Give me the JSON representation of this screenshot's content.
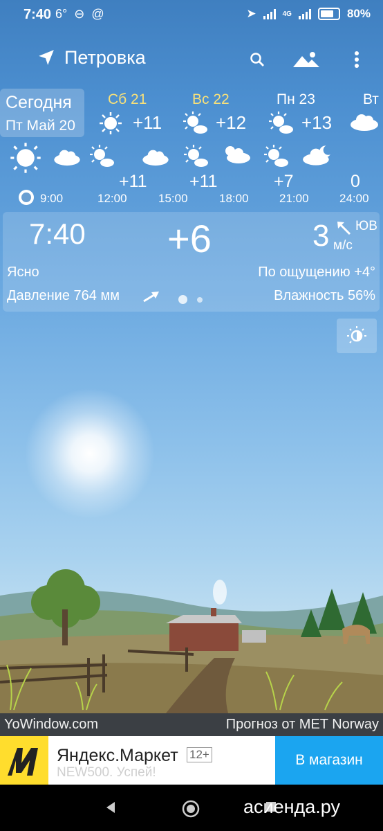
{
  "status_bar": {
    "time": "7:40",
    "temp_badge": "6°",
    "network": "4G",
    "battery": "80%"
  },
  "app_bar": {
    "location": "Петровка",
    "icons": [
      "location-arrow-icon",
      "search-icon",
      "landscape-icon",
      "more-icon"
    ]
  },
  "days": [
    {
      "name": "Сегодня",
      "date": "Пт Май 20"
    },
    {
      "name": "Сб 21",
      "temp": "+11",
      "icon": "sun-icon"
    },
    {
      "name": "Вс 22",
      "temp": "+12",
      "icon": "sun-cloud-icon"
    },
    {
      "name": "Пн 23",
      "temp": "+13",
      "icon": "sun-cloud-icon"
    },
    {
      "name": "Вт",
      "icon": "cloud-icon"
    }
  ],
  "hourly": {
    "temps": [
      "+11",
      "+11",
      "+7",
      "0"
    ],
    "times": [
      "9:00",
      "12:00",
      "15:00",
      "18:00",
      "21:00",
      "24:00"
    ]
  },
  "current": {
    "time": "7:40",
    "temp": "+6",
    "wind_speed": "3",
    "wind_dir": "ЮВ",
    "wind_unit": "м/с",
    "condition": "Ясно",
    "feels_like": "По ощущению +4°",
    "pressure": "Давление 764 мм",
    "humidity": "Влажность 56%"
  },
  "footer": {
    "left": "YoWindow.com",
    "right": "Прогноз от MET Norway"
  },
  "ad": {
    "title": "Яндекс.Маркет",
    "age": "12+",
    "subtitle": "NEW500. Успей!",
    "button": "В магазин"
  },
  "watermark": "асиенда.ру",
  "colors": {
    "day_name_weekend": "#f7e07a",
    "ad_button": "#1ba5f0",
    "ad_logo": "#ffdd2d"
  }
}
